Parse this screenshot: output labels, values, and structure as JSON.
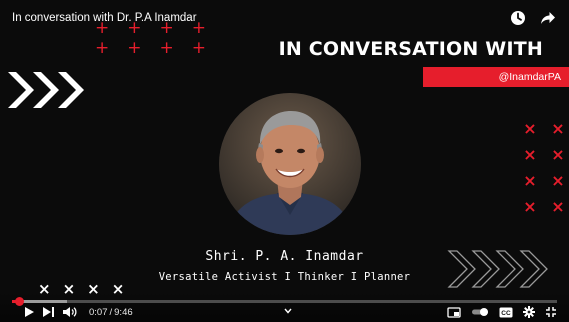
{
  "video": {
    "title": "In conversation with Dr. P.A Inamdar",
    "headline": "IN CONVERSATION WITH",
    "handle": "@InamdarPA",
    "name": "Shri. P. A. Inamdar",
    "tagline": "Versatile Activist I Thinker I Planner",
    "accent_color": "#e61e2c",
    "decor": {
      "plus_marks": [
        "+",
        "+",
        "+",
        "+"
      ],
      "red_x_marks": [
        "×",
        "×",
        "×",
        "×",
        "×",
        "×",
        "×",
        "×"
      ],
      "white_x_marks": [
        "×",
        "×",
        "×",
        "×"
      ]
    }
  },
  "player": {
    "current_time": "0:07",
    "duration": "9:46",
    "progress_fraction": 0.012,
    "buffer_fraction": 0.1,
    "icons": {
      "watch_later": "clock-icon",
      "share": "share-icon",
      "play": "play-icon",
      "next": "next-icon",
      "volume": "volume-icon",
      "expand": "chevron-down-icon",
      "miniplayer": "miniplayer-icon",
      "autoplay": "autoplay-toggle-icon",
      "captions": "captions-icon",
      "settings": "gear-icon",
      "exit_fullscreen": "exit-fullscreen-icon"
    }
  }
}
